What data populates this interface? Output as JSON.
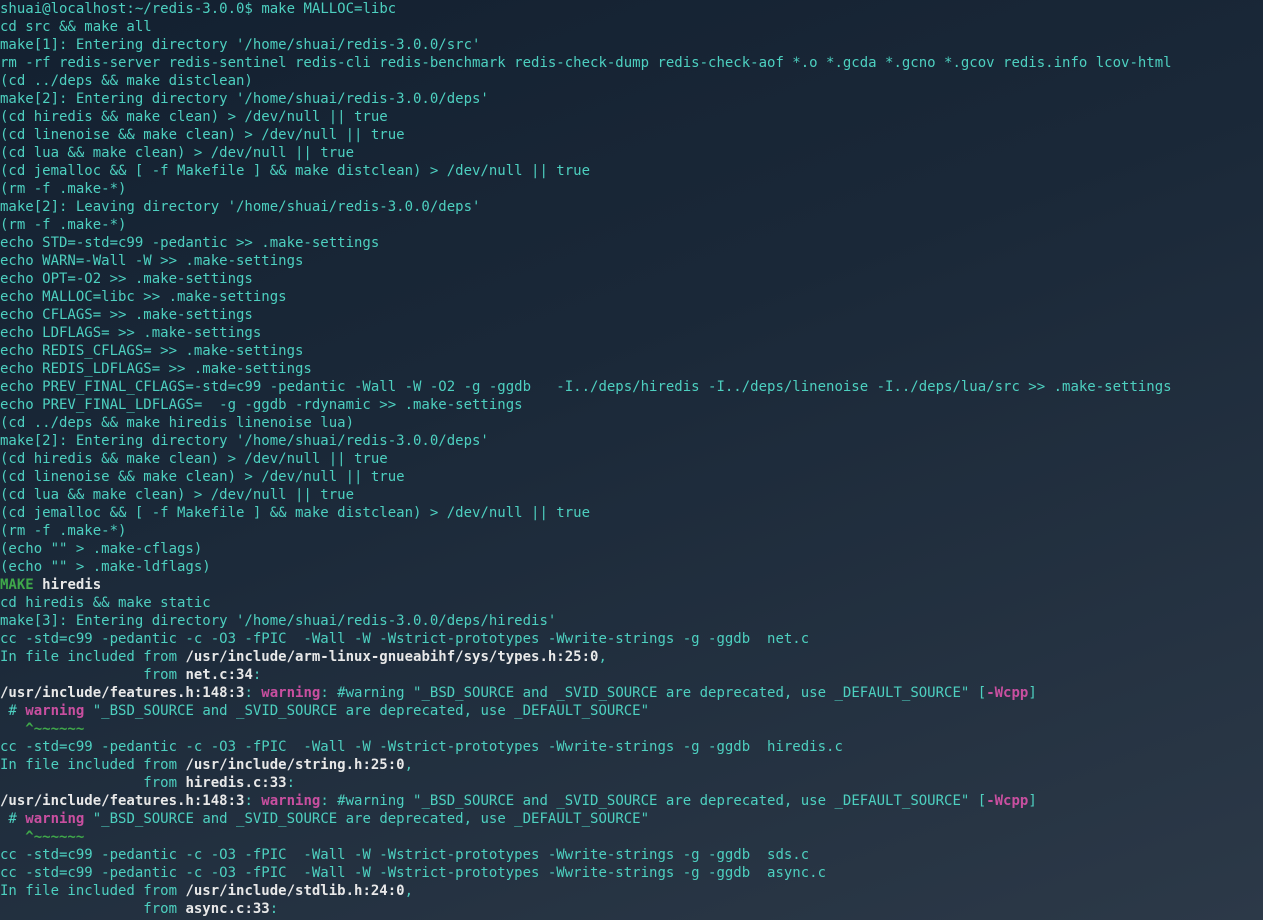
{
  "prompt": "shuai@localhost:~/redis-3.0.0$",
  "command": "make MALLOC=libc",
  "lines": {
    "l01": "cd src && make all",
    "l02": "make[1]: Entering directory '/home/shuai/redis-3.0.0/src'",
    "l03": "rm -rf redis-server redis-sentinel redis-cli redis-benchmark redis-check-dump redis-check-aof *.o *.gcda *.gcno *.gcov redis.info lcov-html",
    "l04": "(cd ../deps && make distclean)",
    "l05": "make[2]: Entering directory '/home/shuai/redis-3.0.0/deps'",
    "l06": "(cd hiredis && make clean) > /dev/null || true",
    "l07": "(cd linenoise && make clean) > /dev/null || true",
    "l08": "(cd lua && make clean) > /dev/null || true",
    "l09": "(cd jemalloc && [ -f Makefile ] && make distclean) > /dev/null || true",
    "l10": "(rm -f .make-*)",
    "l11": "make[2]: Leaving directory '/home/shuai/redis-3.0.0/deps'",
    "l12": "(rm -f .make-*)",
    "l13": "echo STD=-std=c99 -pedantic >> .make-settings",
    "l14": "echo WARN=-Wall -W >> .make-settings",
    "l15": "echo OPT=-O2 >> .make-settings",
    "l16": "echo MALLOC=libc >> .make-settings",
    "l17": "echo CFLAGS= >> .make-settings",
    "l18": "echo LDFLAGS= >> .make-settings",
    "l19": "echo REDIS_CFLAGS= >> .make-settings",
    "l20": "echo REDIS_LDFLAGS= >> .make-settings",
    "l21": "echo PREV_FINAL_CFLAGS=-std=c99 -pedantic -Wall -W -O2 -g -ggdb   -I../deps/hiredis -I../deps/linenoise -I../deps/lua/src >> .make-settings",
    "l22": "echo PREV_FINAL_LDFLAGS=  -g -ggdb -rdynamic >> .make-settings",
    "l23": "(cd ../deps && make hiredis linenoise lua)",
    "l24": "make[2]: Entering directory '/home/shuai/redis-3.0.0/deps'",
    "l25": "(cd hiredis && make clean) > /dev/null || true",
    "l26": "(cd linenoise && make clean) > /dev/null || true",
    "l27": "(cd lua && make clean) > /dev/null || true",
    "l28": "(cd jemalloc && [ -f Makefile ] && make distclean) > /dev/null || true",
    "l29": "(rm -f .make-*)",
    "l30": "(echo \"\" > .make-cflags)",
    "l31": "(echo \"\" > .make-ldflags)",
    "make_label": "MAKE",
    "hiredis_label": "hiredis",
    "l33": "cd hiredis && make static",
    "l34": "make[3]: Entering directory '/home/shuai/redis-3.0.0/deps/hiredis'",
    "l35": "cc -std=c99 -pedantic -c -O3 -fPIC  -Wall -W -Wstrict-prototypes -Wwrite-strings -g -ggdb  net.c",
    "inc_prefix": "In file included from ",
    "from_prefix": "                 from ",
    "loc1": "/usr/include/arm-linux-gnueabihf/sys/types.h:25:0",
    "loc2": "net.c:34",
    "loc3": "/usr/include/features.h:148:3",
    "warn_word": "warning",
    "warn_msg": "#warning \"_BSD_SOURCE and _SVID_SOURCE are deprecated, use _DEFAULT_SOURCE\" [",
    "wcpp": "-Wcpp",
    "close_bracket": "]",
    "hash_space": " # ",
    "warn_inline": " \"_BSD_SOURCE and _SVID_SOURCE are deprecated, use _DEFAULT_SOURCE\"",
    "tildes": "   ^~~~~~~",
    "l40": "cc -std=c99 -pedantic -c -O3 -fPIC  -Wall -W -Wstrict-prototypes -Wwrite-strings -g -ggdb  hiredis.c",
    "loc4": "/usr/include/string.h:25:0",
    "loc5": "hiredis.c:33",
    "l45": "cc -std=c99 -pedantic -c -O3 -fPIC  -Wall -W -Wstrict-prototypes -Wwrite-strings -g -ggdb  sds.c",
    "l46": "cc -std=c99 -pedantic -c -O3 -fPIC  -Wall -W -Wstrict-prototypes -Wwrite-strings -g -ggdb  async.c",
    "loc6": "/usr/include/stdlib.h:24:0",
    "loc7": "async.c:33",
    "colon": ":",
    "colon_space": ": ",
    "comma": ","
  }
}
